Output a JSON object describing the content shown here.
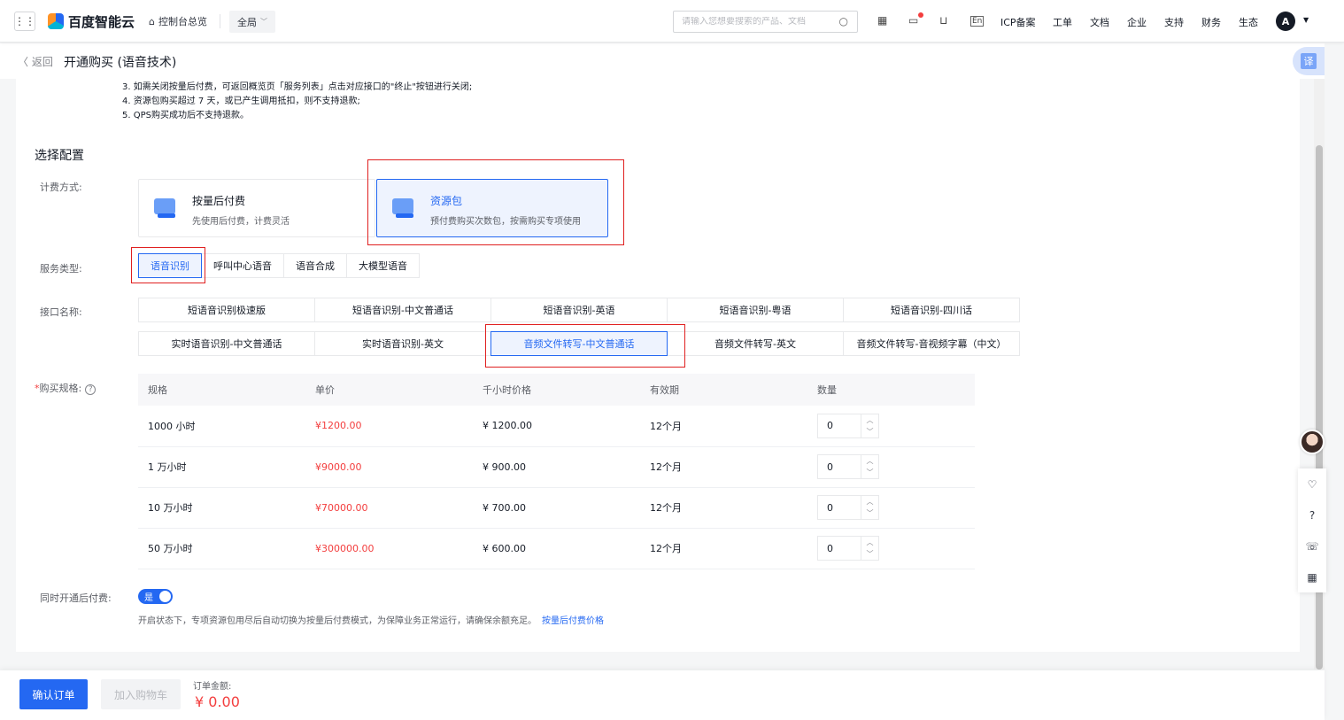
{
  "topnav": {
    "apps_icon": "grid-icon",
    "brand": "百度智能云",
    "home_link": "控制台总览",
    "region": "全局",
    "search_placeholder": "请输入您想要搜索的产品、文档",
    "icons": [
      "qrcode-icon",
      "message-icon",
      "cart-icon",
      "language-icon"
    ],
    "links": [
      "ICP备案",
      "工单",
      "文档",
      "企业",
      "支持",
      "财务",
      "生态"
    ],
    "avatar_letter": "A"
  },
  "subbar": {
    "back_label": "返回",
    "title": "开通购买 (语音技术)",
    "translate_label": "译"
  },
  "notes": [
    "3. 如需关闭按量后付费，可返回概览页「服务列表」点击对应接口的\"终止\"按钮进行关闭;",
    "4. 资源包购买超过 7 天，或已产生调用抵扣，则不支持退款;",
    "5. QPS购买成功后不支持退款。"
  ],
  "config": {
    "section_title": "选择配置",
    "billing_label": "计费方式:",
    "billing_options": [
      {
        "title": "按量后付费",
        "desc": "先使用后付费，计费灵活",
        "selected": false
      },
      {
        "title": "资源包",
        "desc": "预付费购买次数包，按需购买专项使用",
        "selected": true
      }
    ],
    "service_label": "服务类型:",
    "service_types": [
      {
        "label": "语音识别",
        "selected": true
      },
      {
        "label": "呼叫中心语音",
        "selected": false
      },
      {
        "label": "语音合成",
        "selected": false
      },
      {
        "label": "大模型语音",
        "selected": false
      }
    ],
    "api_label": "接口名称:",
    "api_rows": [
      [
        {
          "label": "短语音识别极速版",
          "selected": false
        },
        {
          "label": "短语音识别-中文普通话",
          "selected": false
        },
        {
          "label": "短语音识别-英语",
          "selected": false
        },
        {
          "label": "短语音识别-粤语",
          "selected": false
        },
        {
          "label": "短语音识别-四川话",
          "selected": false
        }
      ],
      [
        {
          "label": "实时语音识别-中文普通话",
          "selected": false
        },
        {
          "label": "实时语音识别-英文",
          "selected": false
        },
        {
          "label": "音频文件转写-中文普通话",
          "selected": true
        },
        {
          "label": "音频文件转写-英文",
          "selected": false
        },
        {
          "label": "音频文件转写-音视频字幕（中文）",
          "selected": false
        }
      ]
    ],
    "spec_label_required": "*",
    "spec_label": "购买规格:",
    "spec_help_icon": "?",
    "spec_headers": [
      "规格",
      "单价",
      "千小时价格",
      "有效期",
      "数量"
    ],
    "spec_rows": [
      {
        "spec": "1000 小时",
        "price": "¥1200.00",
        "per_k": "¥ 1200.00",
        "validity": "12个月",
        "qty": "0"
      },
      {
        "spec": "1 万小时",
        "price": "¥9000.00",
        "per_k": "¥ 900.00",
        "validity": "12个月",
        "qty": "0"
      },
      {
        "spec": "10 万小时",
        "price": "¥70000.00",
        "per_k": "¥ 700.00",
        "validity": "12个月",
        "qty": "0"
      },
      {
        "spec": "50 万小时",
        "price": "¥300000.00",
        "per_k": "¥ 600.00",
        "validity": "12个月",
        "qty": "0"
      }
    ],
    "postpay_label": "同时开通后付费:",
    "postpay_toggle": "是",
    "postpay_on": true,
    "postpay_desc": "开启状态下，专项资源包用尽后自动切换为按量后付费模式，为保障业务正常运行，请确保余额充足。",
    "postpay_link": "按量后付费价格"
  },
  "footer": {
    "confirm_label": "确认订单",
    "cart_label": "加入购物车",
    "amount_label": "订单金额:",
    "amount_value": "¥ 0.00"
  },
  "float_bar": {
    "icons": [
      "heart-icon",
      "help-icon",
      "phone-icon",
      "apps-icon"
    ]
  },
  "colors": {
    "accent": "#2468f2",
    "price": "#f33e3e",
    "highlight_box": "#e02020"
  }
}
